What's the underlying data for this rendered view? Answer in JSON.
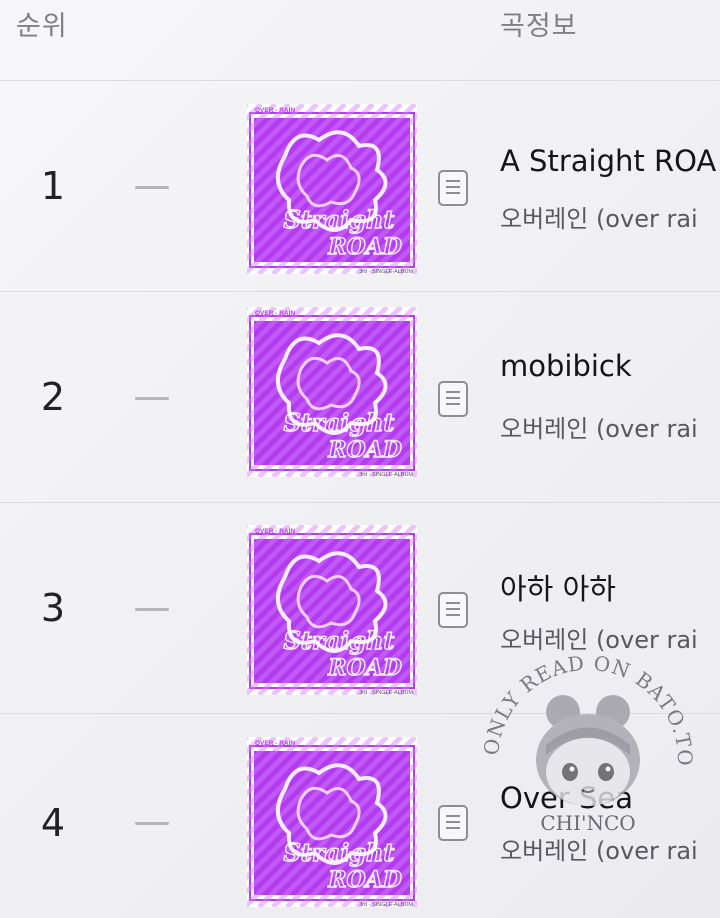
{
  "header": {
    "rank_label": "순위",
    "info_label": "곡정보"
  },
  "rows": [
    {
      "rank": "1",
      "change": "—",
      "title": "A Straight ROA",
      "artist": "오버레인 (over rai"
    },
    {
      "rank": "2",
      "change": "—",
      "title": "mobibick",
      "artist": "오버레인 (over rai"
    },
    {
      "rank": "3",
      "change": "—",
      "title": "아하 아하",
      "artist": "오버레인 (over rai"
    },
    {
      "rank": "4",
      "change": "—",
      "title": "Over Sea",
      "artist": "오버레인 (over rai"
    }
  ],
  "album_cover": {
    "top_text": "OVER - RAIN",
    "word1": "Straight",
    "word2": "ROAD",
    "bottom_text": "3rd · SINGLE-ALBUM",
    "color": "#b43cf0"
  },
  "watermark": {
    "arc_text": "ONLY READ ON BATO.TO",
    "name": "CHI'NCO"
  }
}
